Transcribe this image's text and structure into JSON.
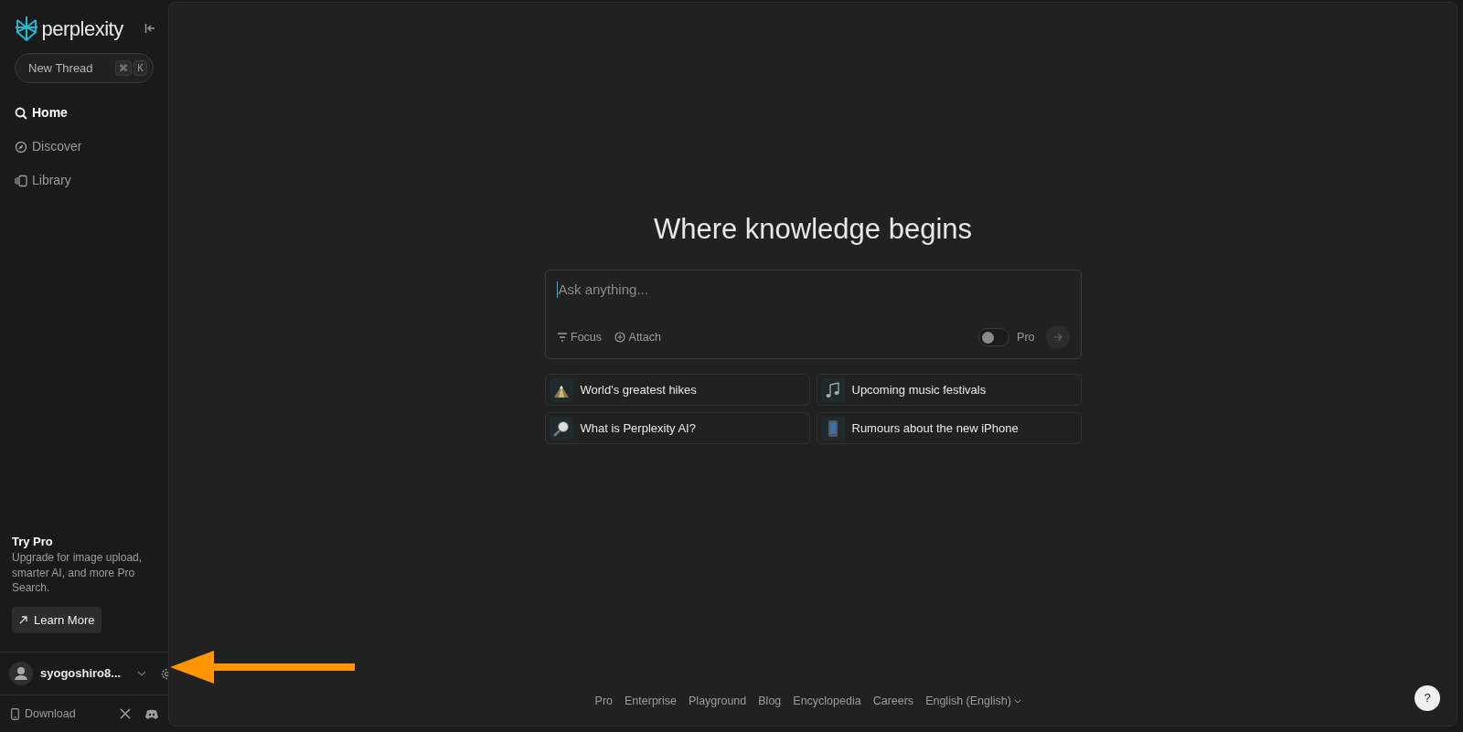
{
  "sidebar": {
    "brand": "perplexity",
    "new_thread": {
      "label": "New Thread",
      "shortcut": [
        "⌘",
        "K"
      ]
    },
    "nav": [
      {
        "label": "Home",
        "selected": true
      },
      {
        "label": "Discover",
        "selected": false
      },
      {
        "label": "Library",
        "selected": false
      }
    ],
    "promo": {
      "title": "Try Pro",
      "text": "Upgrade for image upload, smarter AI, and more Pro Search.",
      "button": "Learn More"
    },
    "user": {
      "name": "syogoshiro8..."
    },
    "download": "Download"
  },
  "main": {
    "heading": "Where knowledge begins",
    "search": {
      "placeholder": "Ask anything...",
      "actions": [
        "Focus",
        "Attach"
      ],
      "pro": {
        "label": "Pro",
        "on": false
      }
    },
    "suggestions": [
      {
        "label": "World's greatest hikes"
      },
      {
        "label": "Upcoming music festivals"
      },
      {
        "label": "What is Perplexity AI?"
      },
      {
        "label": "Rumours about the new iPhone"
      }
    ],
    "footer_links": [
      "Pro",
      "Enterprise",
      "Playground",
      "Blog",
      "Encyclopedia",
      "Careers",
      "English (English)"
    ],
    "help": "?"
  }
}
